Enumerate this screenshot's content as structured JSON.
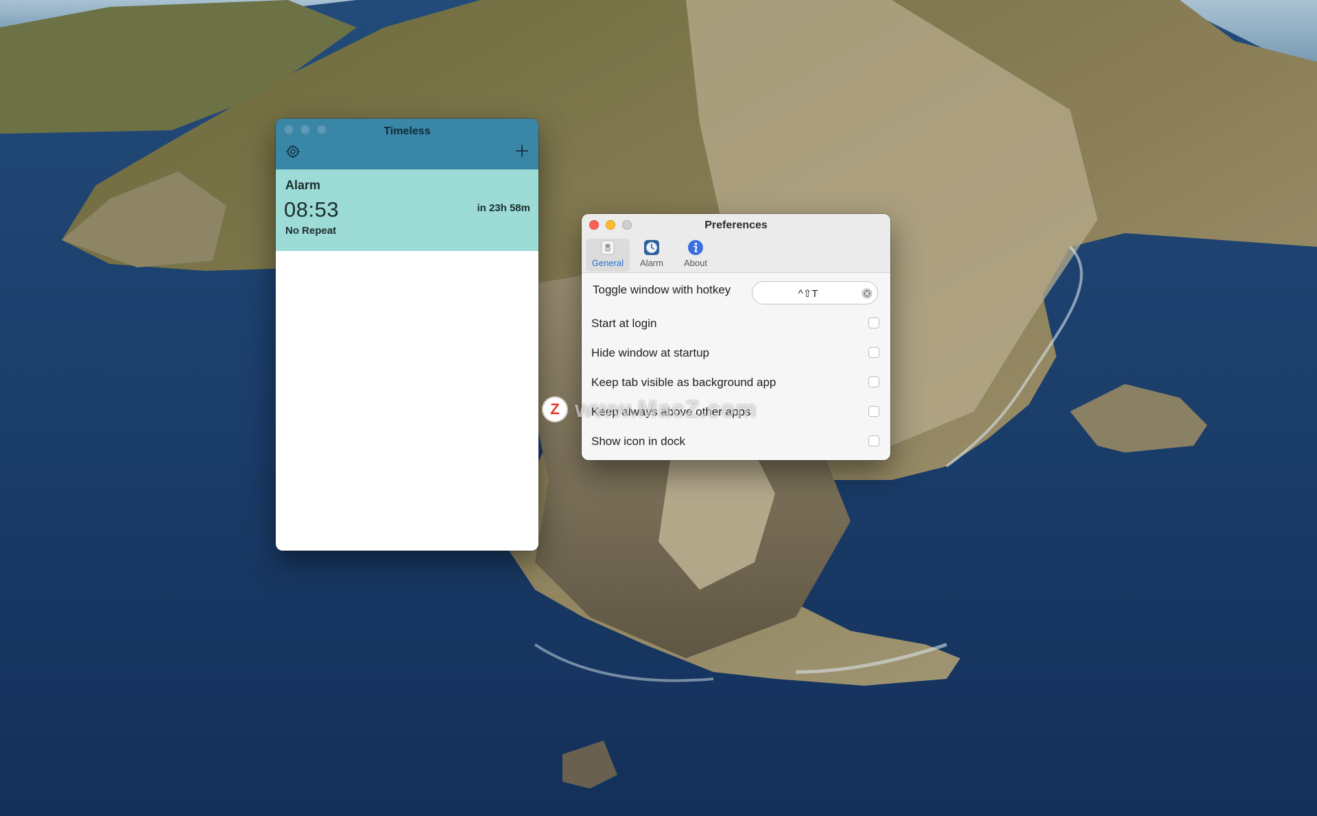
{
  "timeless": {
    "title": "Timeless",
    "alarm": {
      "name": "Alarm",
      "time": "08:53",
      "remaining": "in 23h 58m",
      "repeat": "No Repeat"
    }
  },
  "preferences": {
    "title": "Preferences",
    "tabs": [
      {
        "label": "General",
        "icon": "switch-icon"
      },
      {
        "label": "Alarm",
        "icon": "alarm-clock-icon"
      },
      {
        "label": "About",
        "icon": "info-icon"
      }
    ],
    "hotkey": {
      "label": "Toggle window with hotkey",
      "value": "^⇧T"
    },
    "options": [
      {
        "label": "Start at login"
      },
      {
        "label": "Hide window at startup"
      },
      {
        "label": "Keep tab visible as background app"
      },
      {
        "label": "Keep always above other apps"
      },
      {
        "label": "Show icon in dock"
      }
    ]
  },
  "watermark": {
    "text": "www.MacZ.com",
    "badge": "Z"
  },
  "colors": {
    "timeless_header": "#3a86a6",
    "alarm_card": "#9cdbd6",
    "accent_blue": "#2a6fd2",
    "close": "#fe5f57",
    "minimize": "#febc2e",
    "zoom_inactive": "#cfcfcf"
  }
}
